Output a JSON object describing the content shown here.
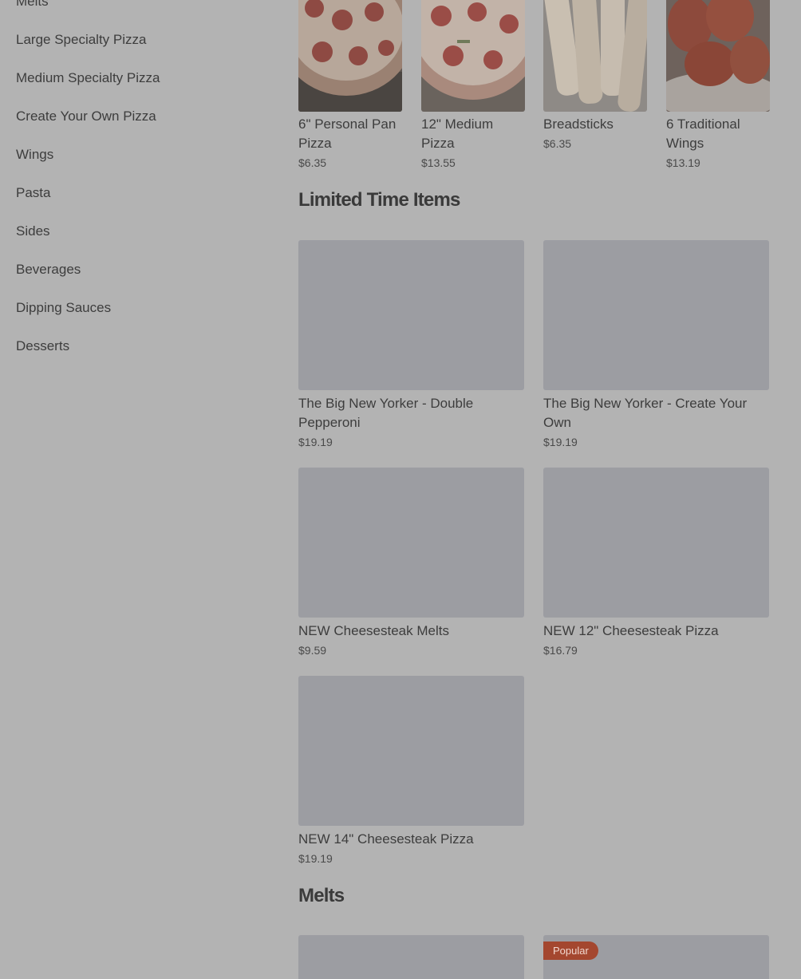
{
  "sidebar": {
    "items": [
      {
        "label": "Melts"
      },
      {
        "label": "Large Specialty Pizza"
      },
      {
        "label": "Medium Specialty Pizza"
      },
      {
        "label": "Create Your Own Pizza"
      },
      {
        "label": "Wings"
      },
      {
        "label": "Pasta"
      },
      {
        "label": "Sides"
      },
      {
        "label": "Beverages"
      },
      {
        "label": "Dipping Sauces"
      },
      {
        "label": "Desserts"
      }
    ]
  },
  "popular_items": [
    {
      "name": "6\" Personal Pan Pizza",
      "price": "$6.35",
      "image": "pepperoni-pan-pizza-photo"
    },
    {
      "name": "12\" Medium Pizza",
      "price": "$13.55",
      "image": "pepperoni-pizza-photo"
    },
    {
      "name": "Breadsticks",
      "price": "$6.35",
      "image": "breadsticks-photo"
    },
    {
      "name": "6 Traditional Wings",
      "price": "$13.19",
      "image": "wings-photo"
    }
  ],
  "limited_time": {
    "title": "Limited Time Items",
    "items": [
      {
        "name": "The Big New Yorker - Double Pepperoni",
        "price": "$19.19"
      },
      {
        "name": "The Big New Yorker - Create Your Own",
        "price": "$19.19"
      },
      {
        "name": "NEW Cheesesteak Melts",
        "price": "$9.59"
      },
      {
        "name": "NEW 12\" Cheesesteak Pizza",
        "price": "$16.79"
      },
      {
        "name": "NEW 14\" Cheesesteak Pizza",
        "price": "$19.19"
      }
    ]
  },
  "melts": {
    "title": "Melts",
    "badge": "Popular"
  },
  "colors": {
    "overlay_background": "#b3b3b3",
    "placeholder": "#9c9da2",
    "badge": "#a4472f"
  }
}
